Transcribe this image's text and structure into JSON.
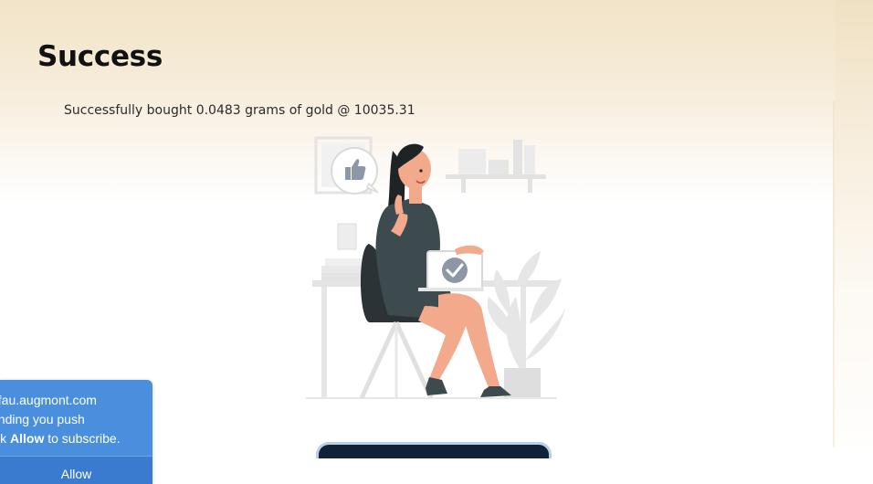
{
  "modal": {
    "title": "Success",
    "message": "Successfully bought 0.0483 grams of gold @ 10035.31",
    "cta_label": ""
  },
  "push_prompt": {
    "line1": "gfau.augmont.com",
    "line2": "ending you push",
    "line3_prefix": "ick ",
    "line3_bold": "Allow",
    "line3_suffix": " to subscribe.",
    "allow_label": "Allow"
  },
  "colors": {
    "accent_blue": "#4a8fde",
    "button_navy": "#0f2238",
    "shirt": "#3d4b4f",
    "skin": "#f3a98b"
  },
  "icons": [
    "thumbs-up-icon",
    "check-circle-icon"
  ]
}
